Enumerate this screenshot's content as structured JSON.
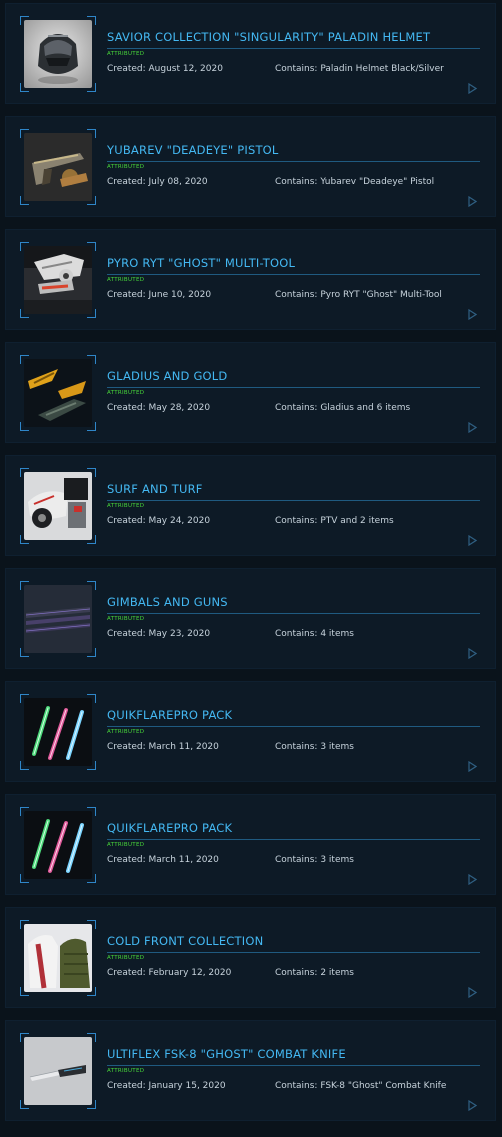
{
  "pledges": [
    {
      "title": "SAVIOR COLLECTION \"SINGULARITY\" PALADIN HELMET",
      "tag": "ATTRIBUTED",
      "created": "Created: August 12, 2020",
      "contains": "Contains: Paladin Helmet Black/Silver",
      "thumb": "helmet"
    },
    {
      "title": "YUBAREV \"DEADEYE\" PISTOL",
      "tag": "ATTRIBUTED",
      "created": "Created: July 08, 2020",
      "contains": "Contains: Yubarev \"Deadeye\" Pistol",
      "thumb": "pistol"
    },
    {
      "title": "PYRO RYT \"GHOST\" MULTI-TOOL",
      "tag": "ATTRIBUTED",
      "created": "Created: June 10, 2020",
      "contains": "Contains: Pyro RYT \"Ghost\" Multi-Tool",
      "thumb": "multitool"
    },
    {
      "title": "GLADIUS AND GOLD",
      "tag": "ATTRIBUTED",
      "created": "Created: May 28, 2020",
      "contains": "Contains: Gladius and 6 items",
      "thumb": "gladius"
    },
    {
      "title": "SURF AND TURF",
      "tag": "ATTRIBUTED",
      "created": "Created: May 24, 2020",
      "contains": "Contains: PTV and 2 items",
      "thumb": "surf"
    },
    {
      "title": "GIMBALS AND GUNS",
      "tag": "ATTRIBUTED",
      "created": "Created: May 23, 2020",
      "contains": "Contains: 4 items",
      "thumb": "gimbals"
    },
    {
      "title": "QUIKFLAREPRO PACK",
      "tag": "ATTRIBUTED",
      "created": "Created: March 11, 2020",
      "contains": "Contains: 3 items",
      "thumb": "flares"
    },
    {
      "title": "QUIKFLAREPRO PACK",
      "tag": "ATTRIBUTED",
      "created": "Created: March 11, 2020",
      "contains": "Contains: 3 items",
      "thumb": "flares"
    },
    {
      "title": "COLD FRONT COLLECTION",
      "tag": "ATTRIBUTED",
      "created": "Created: February 12, 2020",
      "contains": "Contains: 2 items",
      "thumb": "coats"
    },
    {
      "title": "ULTIFLEX FSK-8 \"GHOST\" COMBAT KNIFE",
      "tag": "ATTRIBUTED",
      "created": "Created: January 15, 2020",
      "contains": "Contains: FSK-8 \"Ghost\" Combat Knife",
      "thumb": "knife"
    }
  ],
  "colors": {
    "title": "#44b8f2",
    "tag": "#48d83a",
    "body_text": "#c7d3dc",
    "card_bg": "#0d1a26",
    "frame": "#2f86c8"
  },
  "icons": {
    "open": "play-arrow-icon"
  }
}
